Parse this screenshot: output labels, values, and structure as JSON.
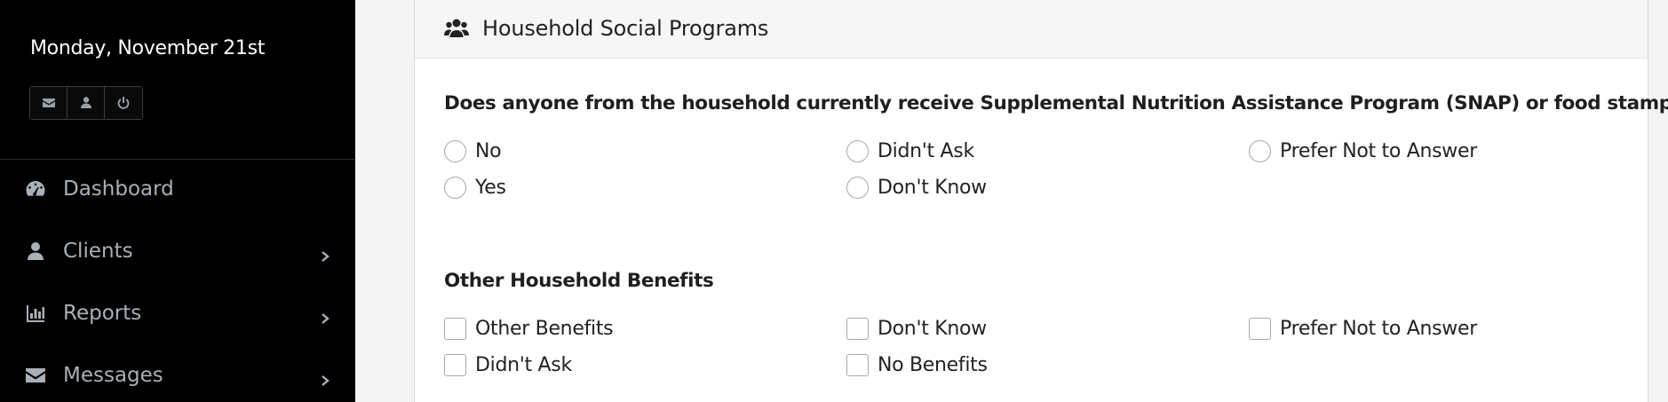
{
  "sidebar": {
    "date": "Monday, November 21st",
    "buttons": [
      {
        "name": "envelope-icon"
      },
      {
        "name": "user-icon"
      },
      {
        "name": "power-icon"
      }
    ],
    "nav": [
      {
        "label": "Dashboard",
        "icon": "dashboard-icon",
        "has_chevron": false
      },
      {
        "label": "Clients",
        "icon": "user-icon",
        "has_chevron": true
      },
      {
        "label": "Reports",
        "icon": "bar-chart-icon",
        "has_chevron": true
      },
      {
        "label": "Messages",
        "icon": "envelope-icon",
        "has_chevron": true
      }
    ]
  },
  "panel": {
    "title": "Household Social Programs",
    "icon": "users-icon",
    "snap": {
      "question": "Does anyone from the household currently receive Supplemental Nutrition Assistance Program (SNAP) or food stamps?",
      "options": [
        "No",
        "Didn't Ask",
        "Prefer Not to Answer",
        "Yes",
        "Don't Know"
      ]
    },
    "benefits": {
      "question": "Other Household Benefits",
      "options": [
        "Other Benefits",
        "Don't Know",
        "Prefer Not to Answer",
        "Didn't Ask",
        "No Benefits"
      ]
    }
  }
}
